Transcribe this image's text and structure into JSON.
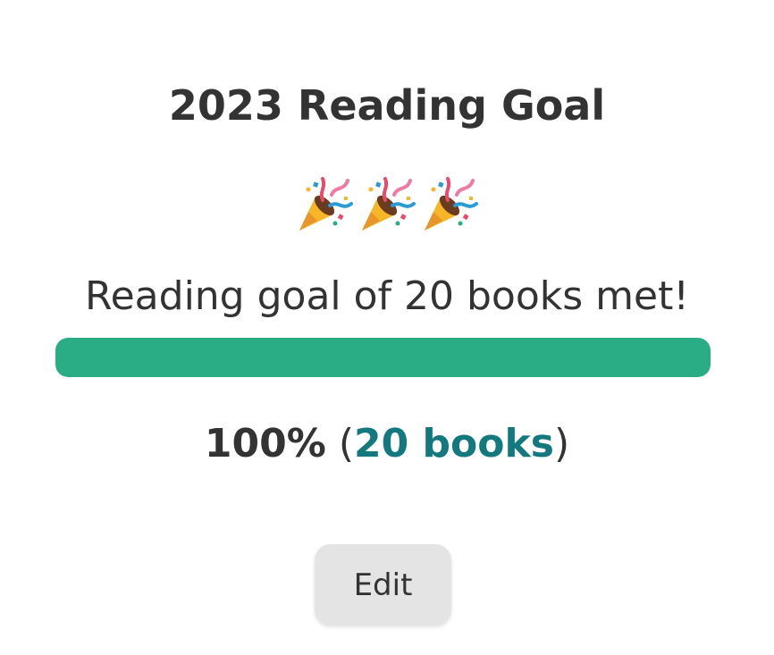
{
  "goal": {
    "title": "2023 Reading Goal",
    "celebration_icons": [
      "party-popper-icon",
      "party-popper-icon",
      "party-popper-icon"
    ],
    "message": "Reading goal of 20 books met!",
    "progress_fraction": 1.0,
    "percent_label": "100%",
    "open_paren": "(",
    "books_label": "20 books",
    "close_paren": ")"
  },
  "actions": {
    "edit_label": "Edit"
  },
  "colors": {
    "progress_fill": "#2aad84",
    "link": "#13797e",
    "text": "#333333",
    "button_bg": "#e4e4e4"
  }
}
